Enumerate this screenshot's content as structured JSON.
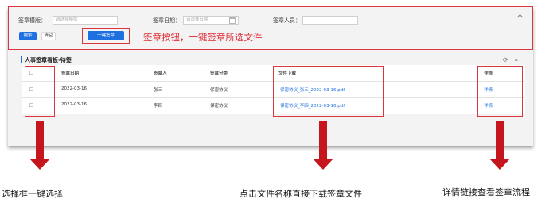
{
  "filter": {
    "sign_template_label": "签章模版：",
    "sign_template_placeholder": "请选择模版",
    "sign_date_label": "签章日期：",
    "sign_date_placeholder": "请选择日期",
    "signer_label": "签章人员："
  },
  "actions": {
    "search": "搜索",
    "clear": "清空",
    "one_key_sign": "一键签章"
  },
  "section_title": "人事签章看板-待签",
  "table": {
    "columns": [
      "签章日期",
      "签章人",
      "签章分类",
      "文件下载",
      "详情"
    ],
    "rows": [
      {
        "date": "2022-03-16",
        "signer": "张三",
        "category": "保密协议",
        "file": "保密协议_张三_2022-03-16.pdf",
        "detail": "详情"
      },
      {
        "date": "2022-03-16",
        "signer": "李四",
        "category": "保密协议",
        "file": "保密协议_李四_2022-03-16.pdf",
        "detail": "详情"
      }
    ]
  },
  "annotations": {
    "sign_button_note": "签章按钮，一键签章所选文件",
    "checkbox_caption": "选择框一键选择",
    "download_caption": "点击文件名称直接下载签章文件",
    "detail_caption": "详情链接查看签章流程"
  },
  "colors": {
    "primary": "#1e6fe0",
    "annotation_red": "#e0313a",
    "arrow_red": "#c4161c"
  }
}
